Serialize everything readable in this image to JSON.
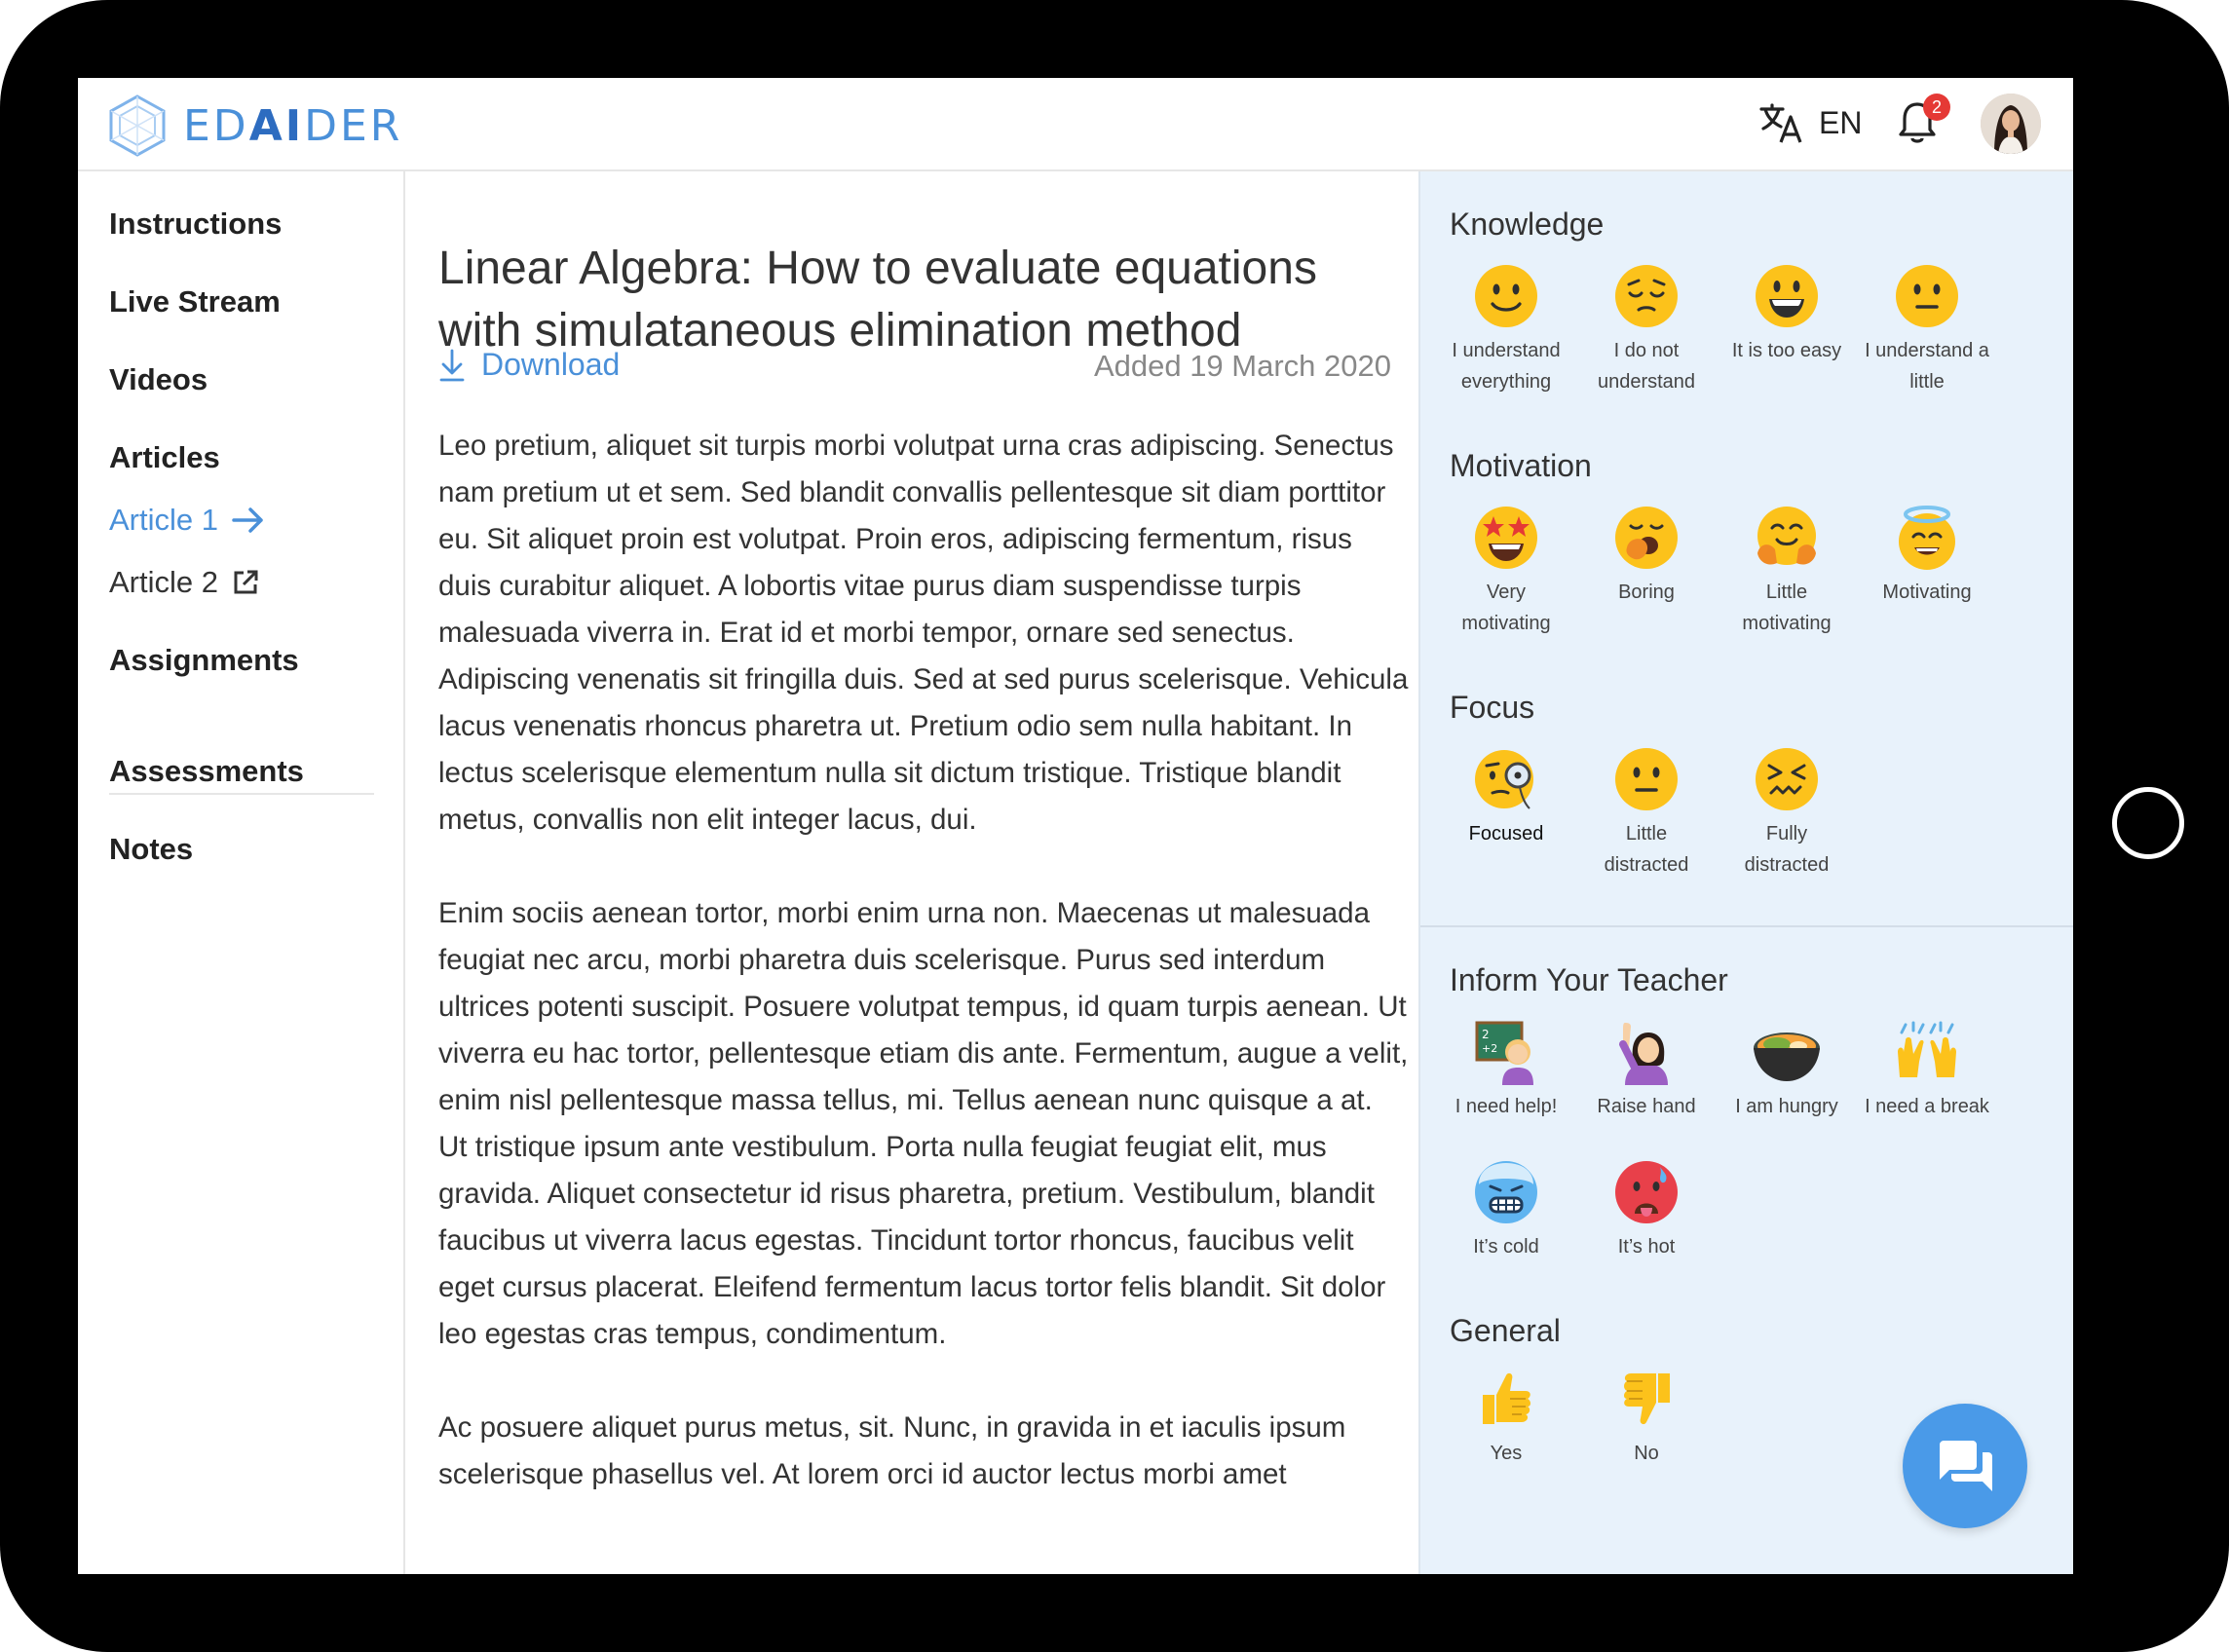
{
  "app": {
    "logo_prefix": "ED",
    "logo_ai": "AI",
    "logo_suffix": "DER",
    "language": "EN",
    "notification_count": "2"
  },
  "sidebar": {
    "items": [
      {
        "label": "Instructions"
      },
      {
        "label": "Live Stream"
      },
      {
        "label": "Videos"
      },
      {
        "label": "Articles"
      },
      {
        "label": "Assignments"
      },
      {
        "label": "Assessments"
      },
      {
        "label": "Notes"
      }
    ],
    "articles": [
      {
        "label": "Article 1",
        "icon": "arrow-right-icon"
      },
      {
        "label": "Article 2",
        "icon": "external-link-icon"
      }
    ]
  },
  "article": {
    "title": "Linear Algebra: How to evaluate equations with simulataneous elimination method",
    "download_label": "Download",
    "added": "Added 19 March 2020",
    "paragraphs": [
      "Leo pretium, aliquet sit turpis morbi volutpat urna cras adipiscing. Senectus nam pretium ut et sem. Sed blandit convallis pellentesque sit diam porttitor eu. Sit aliquet proin est volutpat. Proin eros, adipiscing fermentum, risus duis curabitur aliquet. A lobortis vitae purus diam suspendisse turpis malesuada viverra in. Erat id et morbi tempor, ornare sed senectus. Adipiscing venenatis sit fringilla duis. Sed at sed purus scelerisque. Vehicula lacus venenatis rhoncus pharetra ut. Pretium odio sem nulla habitant. In lectus scelerisque elementum nulla sit dictum tristique. Tristique blandit metus, convallis non elit integer lacus, dui.",
      "Enim sociis aenean tortor, morbi enim urna non. Maecenas ut malesuada feugiat nec arcu, morbi pharetra duis scelerisque. Purus sed interdum ultrices potenti suscipit. Posuere volutpat tempus, id quam turpis aenean. Ut viverra eu hac tortor, pellentesque etiam dis ante. Fermentum, augue a velit, enim nisl pellentesque massa tellus, mi. Tellus aenean nunc quisque a at. Ut tristique ipsum ante vestibulum. Porta nulla feugiat feugiat elit, mus gravida. Aliquet consectetur id risus pharetra, pretium. Vestibulum, blandit faucibus ut viverra lacus egestas. Tincidunt tortor rhoncus, faucibus velit eget cursus placerat. Eleifend fermentum lacus tortor felis blandit. Sit dolor leo egestas cras tempus, condimentum.",
      "Ac posuere aliquet purus metus, sit. Nunc, in gravida in et iaculis ipsum scelerisque phasellus vel. At lorem orci id auctor lectus morbi amet"
    ]
  },
  "panel": {
    "knowledge": {
      "title": "Knowledge",
      "items": [
        {
          "l1": "I understand",
          "l2": "everything",
          "icon": "smile-icon"
        },
        {
          "l1": "I do not",
          "l2": "understand",
          "icon": "pensive-icon"
        },
        {
          "l1": "It is too easy",
          "l2": "",
          "icon": "grin-icon"
        },
        {
          "l1": "I understand a",
          "l2": "little",
          "icon": "neutral-face-icon"
        }
      ]
    },
    "motivation": {
      "title": "Motivation",
      "items": [
        {
          "l1": "Very",
          "l2": "motivating",
          "icon": "star-eyes-icon"
        },
        {
          "l1": "Boring",
          "l2": "",
          "icon": "yawn-icon"
        },
        {
          "l1": "Little",
          "l2": "motivating",
          "icon": "hug-icon"
        },
        {
          "l1": "Motivating",
          "l2": "",
          "icon": "halo-icon"
        }
      ]
    },
    "focus": {
      "title": "Focus",
      "items": [
        {
          "l1": "Focused",
          "l2": "",
          "icon": "monocle-icon"
        },
        {
          "l1": "Little",
          "l2": "distracted",
          "icon": "neutral-face-icon"
        },
        {
          "l1": "Fully",
          "l2": "distracted",
          "icon": "confounded-icon"
        }
      ]
    },
    "inform": {
      "title": "Inform Your Teacher",
      "items": [
        {
          "l1": "I need help!",
          "icon": "teacher-icon"
        },
        {
          "l1": "Raise hand",
          "icon": "raise-hand-icon"
        },
        {
          "l1": "I am hungry",
          "icon": "food-bowl-icon"
        },
        {
          "l1": "I need a break",
          "icon": "raised-hands-icon"
        },
        {
          "l1": "It’s cold",
          "icon": "cold-face-icon"
        },
        {
          "l1": "It’s hot",
          "icon": "hot-face-icon"
        }
      ]
    },
    "general": {
      "title": "General",
      "items": [
        {
          "l1": "Yes",
          "icon": "thumbs-up-icon"
        },
        {
          "l1": "No",
          "icon": "thumbs-down-icon"
        }
      ]
    }
  },
  "colors": {
    "accent": "#4a90d9",
    "panel_bg": "#e8f2fb",
    "emoji_yellow": "#fcc21b",
    "badge": "#e53935"
  }
}
